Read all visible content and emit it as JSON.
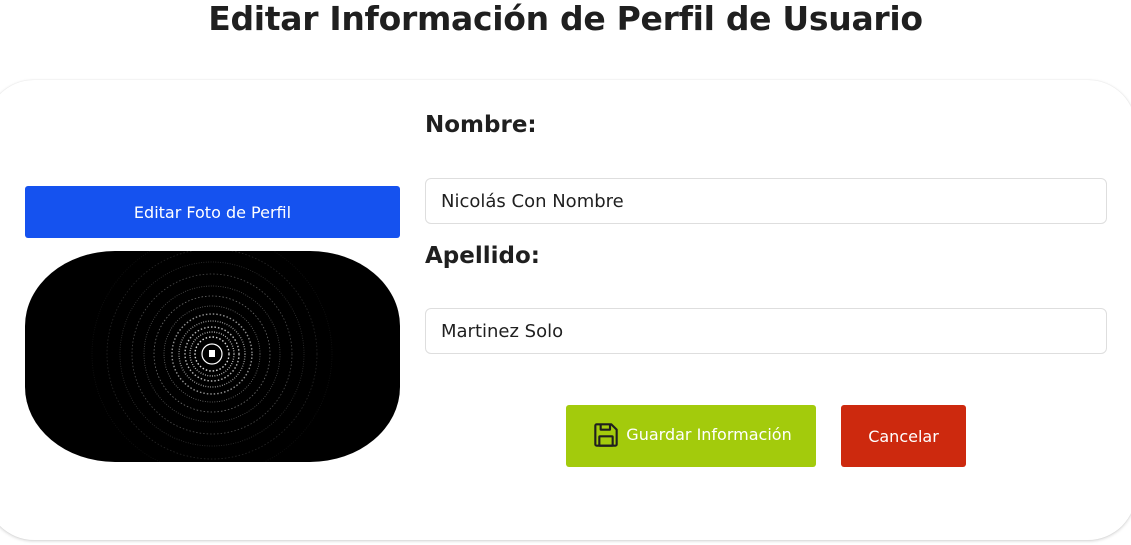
{
  "page": {
    "title": "Editar Información de Perfil de Usuario"
  },
  "photo": {
    "edit_button_label": "Editar Foto de Perfil",
    "image_icon": "mandala-profile-image"
  },
  "form": {
    "first_name": {
      "label": "Nombre:",
      "value": "Nicolás Con Nombre"
    },
    "last_name": {
      "label": "Apellido:",
      "value": "Martinez Solo"
    }
  },
  "actions": {
    "save_label": "Guardar Información",
    "save_icon": "floppy-disk-icon",
    "cancel_label": "Cancelar"
  },
  "colors": {
    "primary_blue": "#1552ef",
    "save_green": "#a3cb0c",
    "cancel_red": "#cd290e",
    "text_dark": "#1f1f1f"
  }
}
